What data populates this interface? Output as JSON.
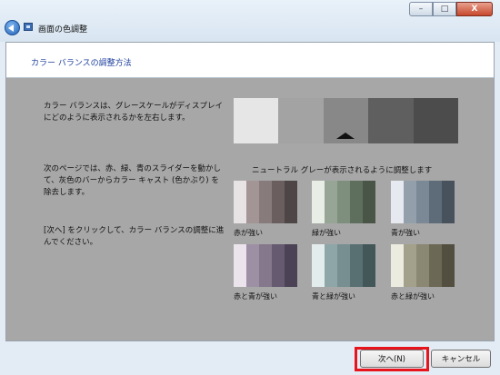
{
  "window": {
    "title": "画面の色調整",
    "controls": {
      "minimize": "–",
      "maximize": "□",
      "close": "X"
    }
  },
  "header": {
    "title": "カラー バランスの調整方法"
  },
  "instructions": {
    "p1": "カラー バランスは、グレースケールがディスプレイにどのように表示されるかを左右します。",
    "p2": "次のページでは、赤、緑、青のスライダーを動かして、灰色のバーからカラー キャスト (色かぶり) を除去します。",
    "p3": "[次へ] をクリックして、カラー バランスの調整に進んでください。"
  },
  "neutral": {
    "label": "ニュートラル グレーが表示されるように調整します",
    "colors": [
      "#e6e6e6",
      "#a3a3a3",
      "#888888",
      "#5f5f5f",
      "#4c4c4c"
    ]
  },
  "swatches": [
    {
      "label": "赤が強い",
      "colors": [
        "#e7e3e4",
        "#a39596",
        "#887b7c",
        "#6b5e5f",
        "#4e4546"
      ]
    },
    {
      "label": "緑が強い",
      "colors": [
        "#e8eee6",
        "#97a596",
        "#7f8f7d",
        "#5f6f5d",
        "#495546"
      ]
    },
    {
      "label": "青が強い",
      "colors": [
        "#e6eaf0",
        "#93a0ab",
        "#7b8895",
        "#5e6b78",
        "#47525d"
      ]
    },
    {
      "label": "赤と青が強い",
      "colors": [
        "#ebe4ec",
        "#9d90a4",
        "#85778c",
        "#665a70",
        "#4c4256"
      ]
    },
    {
      "label": "青と緑が強い",
      "colors": [
        "#e2eced",
        "#8fa6a8",
        "#778f90",
        "#587072",
        "#435658"
      ]
    },
    {
      "label": "赤と緑が強い",
      "colors": [
        "#ecebe0",
        "#a3a08b",
        "#8a8773",
        "#6b6855",
        "#524f40"
      ]
    }
  ],
  "footer": {
    "next_label": "次へ(N)",
    "cancel_label": "キャンセル"
  },
  "accent": {
    "highlight": "#e8141c",
    "header_text": "#1d3e9c"
  }
}
